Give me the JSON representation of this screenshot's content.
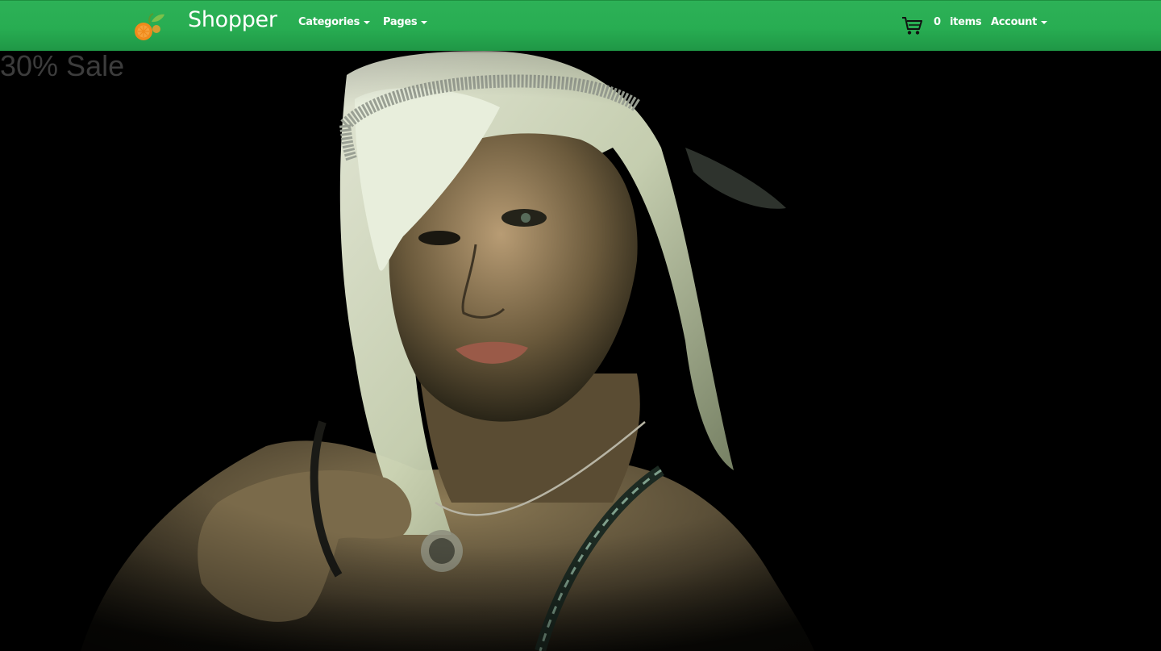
{
  "navbar": {
    "brand": "Shopper",
    "logo_icon": "orange-fruit-logo-icon",
    "menu": [
      {
        "label": "Categories",
        "icon": "caret-down-icon"
      },
      {
        "label": "Pages",
        "icon": "caret-down-icon"
      }
    ],
    "cart": {
      "icon": "shopping-cart-icon",
      "count": "0",
      "items_label": "items"
    },
    "account": {
      "label": "Account",
      "icon": "caret-down-icon"
    }
  },
  "hero": {
    "banner_text": "30% Sale",
    "image_subject": "woman-with-white-hair-and-headband"
  },
  "colors": {
    "navbar_green": "#2bb056",
    "hero_background": "#000000",
    "banner_text": "#3c3c3c"
  }
}
